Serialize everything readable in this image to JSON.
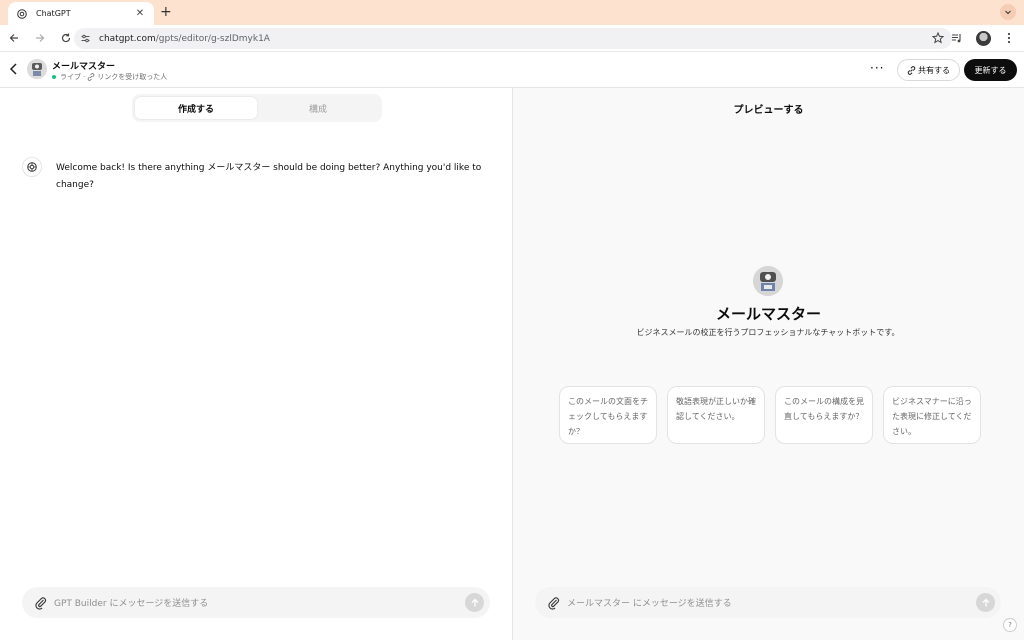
{
  "browser": {
    "tab_title": "ChatGPT",
    "tab_close": "✕",
    "new_tab": "+",
    "url_host": "chatgpt.com",
    "url_path": "/gpts/editor/g-szlDmyk1A"
  },
  "header": {
    "gpt_name": "メールマスター",
    "status_live": "ライブ",
    "status_sep": "·",
    "status_audience": "リンクを受け取った人",
    "more": "···",
    "share_label": "共有する",
    "update_label": "更新する"
  },
  "builder": {
    "tabs": [
      {
        "label": "作成する",
        "active": true
      },
      {
        "label": "構成",
        "active": false
      }
    ],
    "message": "Welcome back! Is there anything メールマスター should be doing better? Anything you'd like to change?",
    "composer_placeholder": "GPT Builder にメッセージを送信する"
  },
  "preview": {
    "title": "プレビューする",
    "name": "メールマスター",
    "description": "ビジネスメールの校正を行うプロフェッショナルなチャットボットです。",
    "starters": [
      "このメールの文面をチェックしてもらえますか？",
      "敬語表現が正しいか確認してください。",
      "このメールの構成を見直してもらえますか？",
      "ビジネスマナーに沿った表現に修正してください。"
    ],
    "composer_placeholder": "メールマスター にメッセージを送信する",
    "help": "?"
  },
  "colors": {
    "tabbar_bg": "#fde2cf",
    "live_dot": "#19c37d",
    "update_button_bg": "#0d0d0d"
  }
}
